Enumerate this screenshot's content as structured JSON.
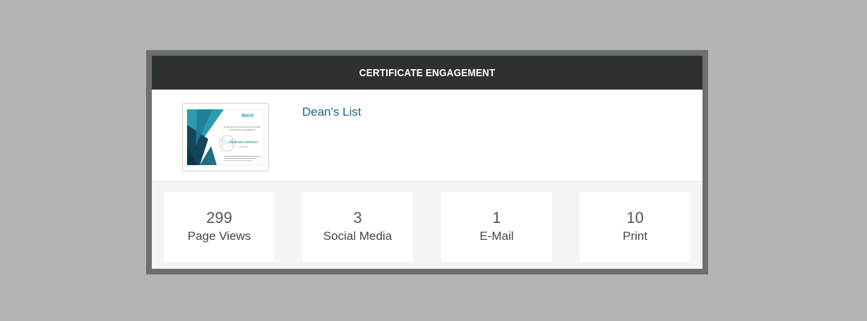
{
  "header": {
    "title": "CERTIFICATE ENGAGEMENT"
  },
  "certificate": {
    "title": "Dean's List",
    "thumbnail": {
      "brand": "Merit",
      "line1": "IN RECOGNITION OF OUTSTANDING",
      "line2": "ACADEMIC ACHIEVEMENT",
      "recipient": "CRISTIAN ORTEGA",
      "term": "Fall 2022",
      "accent_color": "#2a9cb0",
      "dark_color": "#14465a"
    }
  },
  "stats": [
    {
      "value": "299",
      "label": "Page Views"
    },
    {
      "value": "3",
      "label": "Social Media"
    },
    {
      "value": "1",
      "label": "E-Mail"
    },
    {
      "value": "10",
      "label": "Print"
    }
  ],
  "colors": {
    "header_bg": "#2d322f",
    "link": "#1e6384",
    "frame_border": "#6e6e6e"
  }
}
